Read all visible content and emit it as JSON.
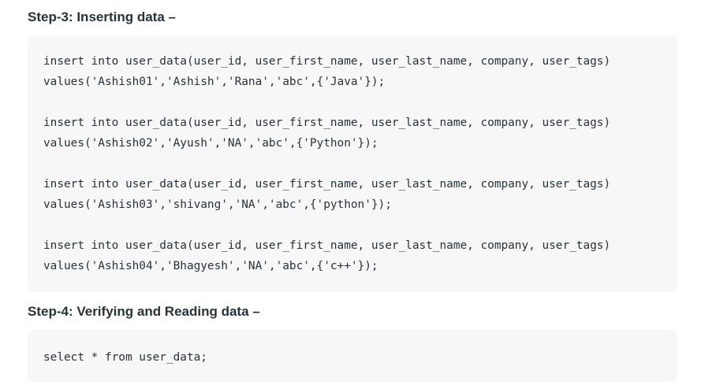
{
  "sections": [
    {
      "heading": "Step-3: Inserting data –",
      "code": [
        "insert into user_data(user_id, user_first_name, user_last_name, company, user_tags)",
        "values('Ashish01','Ashish','Rana','abc',{'Java'});",
        "",
        "insert into user_data(user_id, user_first_name, user_last_name, company, user_tags)",
        "values('Ashish02','Ayush','NA','abc',{'Python'});",
        "",
        "insert into user_data(user_id, user_first_name, user_last_name, company, user_tags)",
        "values('Ashish03','shivang','NA','abc',{'python'});",
        "",
        "insert into user_data(user_id, user_first_name, user_last_name, company, user_tags)",
        "values('Ashish04','Bhagyesh','NA','abc',{'c++'});"
      ]
    },
    {
      "heading": "Step-4: Verifying and Reading data –",
      "code": [
        "select * from user_data;"
      ]
    }
  ]
}
